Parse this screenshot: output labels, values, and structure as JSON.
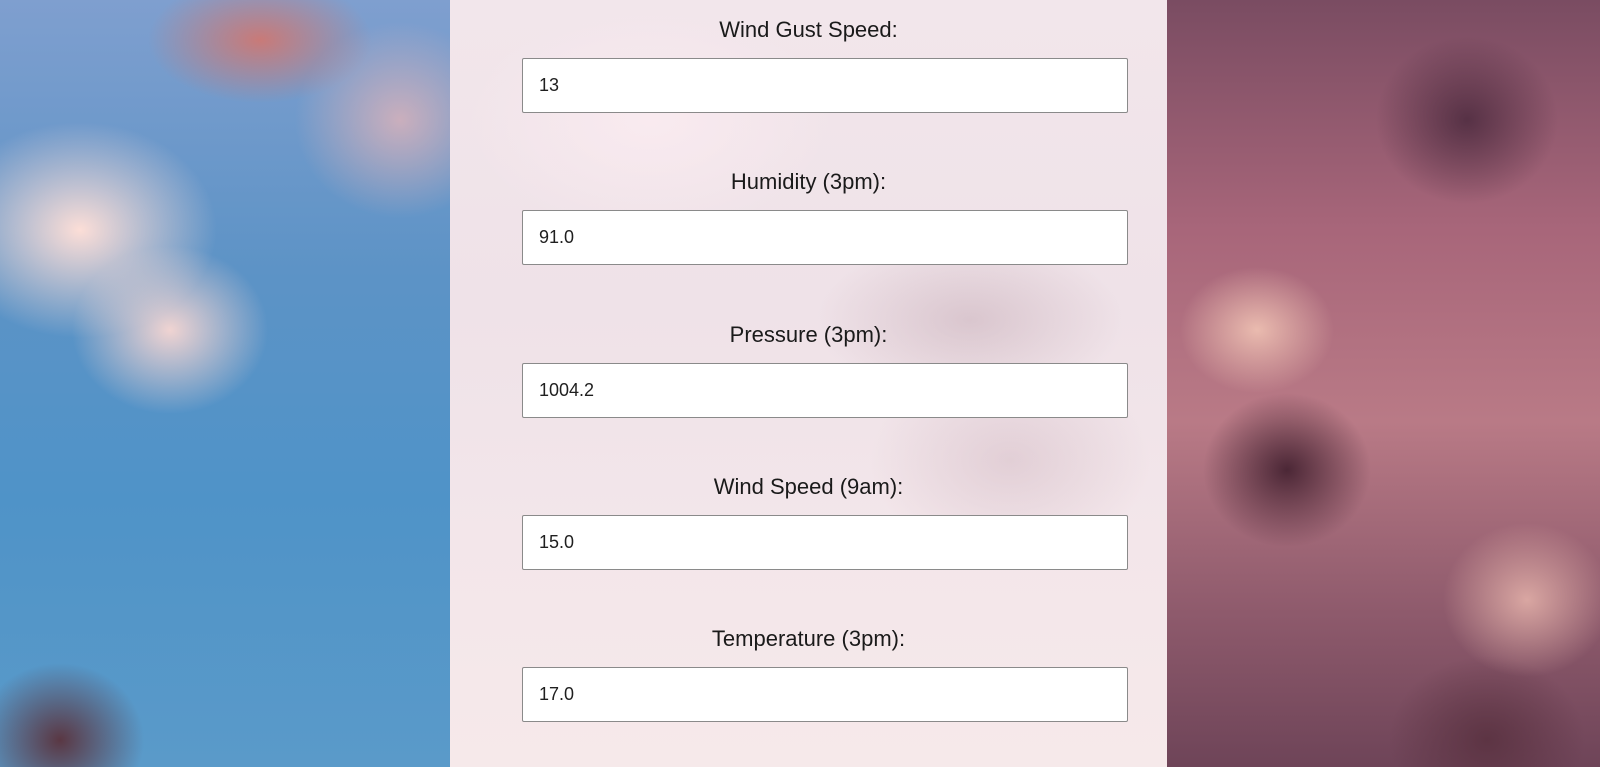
{
  "form": {
    "fields": [
      {
        "label": "Wind Gust Speed:",
        "value": "13"
      },
      {
        "label": "Humidity (3pm):",
        "value": "91.0"
      },
      {
        "label": "Pressure (3pm):",
        "value": "1004.2"
      },
      {
        "label": "Wind Speed (9am):",
        "value": "15.0"
      },
      {
        "label": "Temperature (3pm):",
        "value": "17.0"
      }
    ]
  }
}
